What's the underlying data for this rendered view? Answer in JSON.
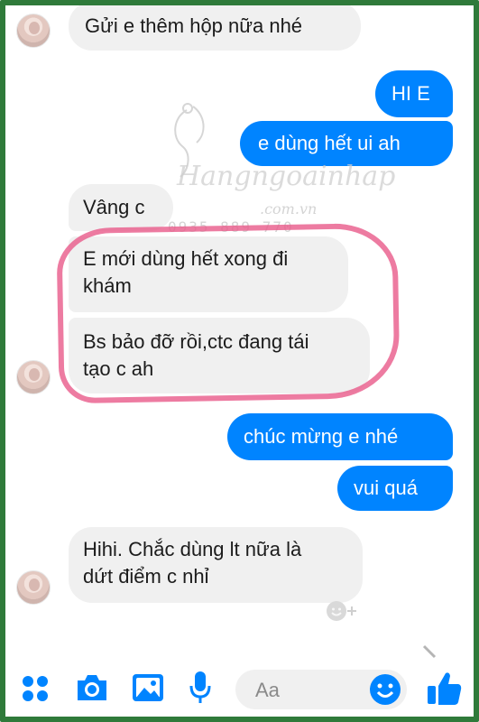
{
  "messages": {
    "m1": "Gửi e thêm hộp nữa nhé",
    "m2": "HI E",
    "m3": "e dùng hết ui ah",
    "m4": "Vâng c",
    "m5_line1": "E mới dùng hết xong đi",
    "m5_line2": "khám",
    "m6_line1": "Bs bảo đỡ rồi,ctc đang tái",
    "m6_line2": "tạo c ah",
    "m7": "chúc mừng e nhé",
    "m8": "vui quá",
    "m9_line1": "Hihi. Chắc dùng lt nữa là",
    "m9_line2": "dứt điểm c nhỉ"
  },
  "watermark": {
    "brand": "Hangngoainhap",
    "phone": "0935 889 770",
    "domain": ".com.vn"
  },
  "composer": {
    "placeholder": "Aa"
  },
  "icons": {
    "apps": "apps-grid-icon",
    "camera": "camera-icon",
    "gallery": "image-icon",
    "mic": "microphone-icon",
    "emoji": "emoji-icon",
    "like": "thumbs-up-icon",
    "react": "add-reaction-icon"
  },
  "colors": {
    "outgoing": "#0084ff",
    "incoming": "#f0f0f0",
    "highlight": "#e95a8a",
    "frame": "#2f7a3a"
  }
}
